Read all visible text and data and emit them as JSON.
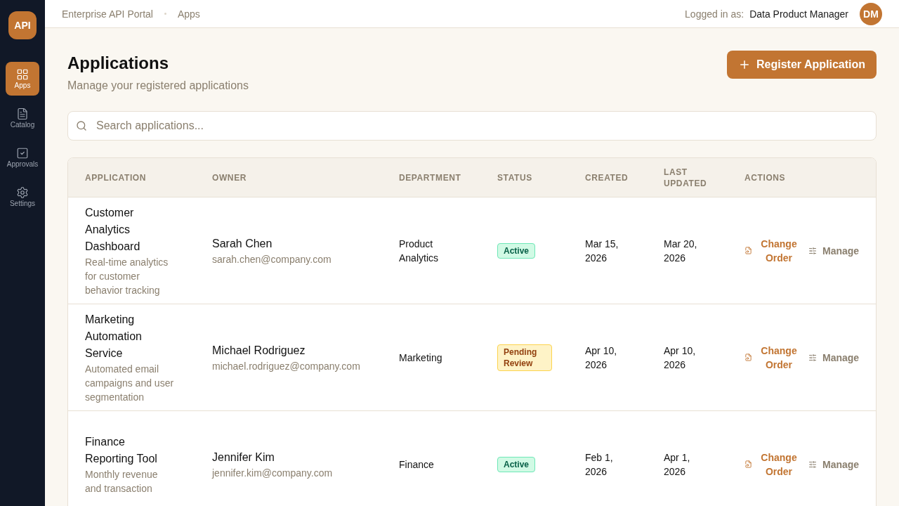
{
  "sidebar": {
    "logo": "API",
    "items": [
      {
        "label": "Apps",
        "kind": "grid",
        "selected": true
      },
      {
        "label": "Catalog",
        "kind": "document",
        "selected": false
      },
      {
        "label": "Approvals",
        "kind": "checkbox",
        "selected": false
      },
      {
        "label": "Settings",
        "kind": "gear",
        "selected": false
      }
    ]
  },
  "topbar": {
    "breadcrumbs": [
      "Enterprise API Portal",
      "Apps"
    ],
    "user_label": "Logged in as:",
    "user_name": "Data Product Manager",
    "avatar": "DM"
  },
  "page": {
    "title": "Applications",
    "subtitle": "Manage your registered applications",
    "register_button": "Register Application"
  },
  "search": {
    "placeholder": "Search applications..."
  },
  "table": {
    "columns": [
      "APPLICATION",
      "OWNER",
      "DEPARTMENT",
      "STATUS",
      "CREATED",
      "LAST UPDATED",
      "ACTIONS"
    ],
    "rows": [
      {
        "name": "Customer Analytics Dashboard",
        "description": "Real-time analytics for customer behavior tracking",
        "owner": "Sarah Chen",
        "email": "sarah.chen@company.com",
        "department": "Product Analytics",
        "status": {
          "label": "Active",
          "kind": "active"
        },
        "created": "Mar 15, 2026",
        "updated": "Mar 20, 2026",
        "actions": [
          "Change Order",
          "Manage"
        ]
      },
      {
        "name": "Marketing Automation Service",
        "description": "Automated email campaigns and user segmentation",
        "owner": "Michael Rodriguez",
        "email": "michael.rodriguez@company.com",
        "department": "Marketing",
        "status": {
          "label": "Pending Review",
          "kind": "pending"
        },
        "created": "Apr 10, 2026",
        "updated": "Apr 10, 2026",
        "actions": [
          "Change Order",
          "Manage"
        ]
      },
      {
        "name": "Finance Reporting Tool",
        "description": "Monthly revenue and transaction",
        "owner": "Jennifer Kim",
        "email": "jennifer.kim@company.com",
        "department": "Finance",
        "status": {
          "label": "Active",
          "kind": "active"
        },
        "created": "Feb 1, 2026",
        "updated": "Apr 1, 2026",
        "actions": [
          "Change Order",
          "Manage"
        ]
      }
    ]
  }
}
